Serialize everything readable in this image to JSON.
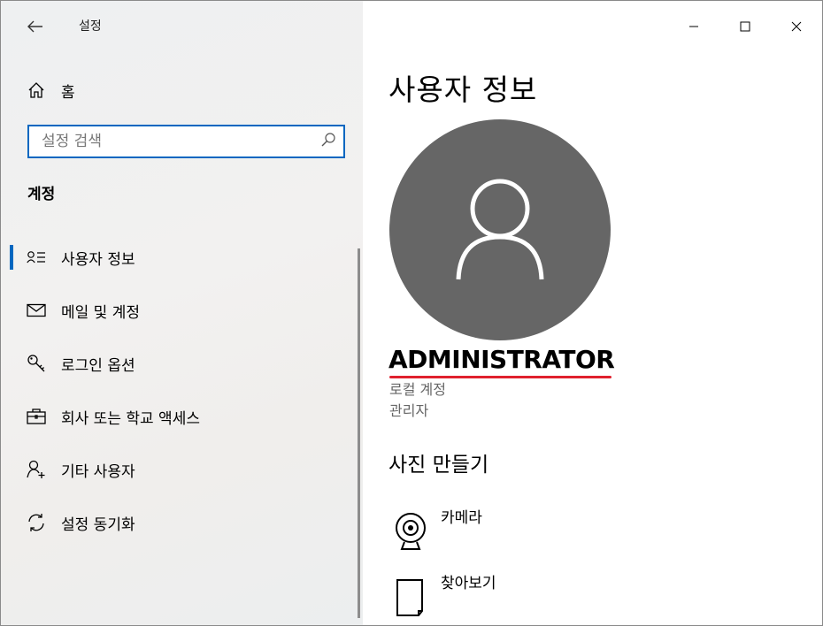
{
  "window": {
    "app_title": "설정",
    "controls": {
      "minimize": "minimize-icon",
      "maximize": "maximize-icon",
      "close": "close-icon"
    }
  },
  "sidebar": {
    "back_icon": "back-arrow-icon",
    "home": {
      "label": "홈",
      "icon": "home-icon"
    },
    "search": {
      "placeholder": "설정 검색",
      "value": "",
      "icon": "search-icon"
    },
    "section_title": "계정",
    "items": [
      {
        "label": "사용자 정보",
        "icon": "user-info-icon",
        "selected": true
      },
      {
        "label": "메일 및 계정",
        "icon": "mail-icon",
        "selected": false
      },
      {
        "label": "로그인 옵션",
        "icon": "key-icon",
        "selected": false
      },
      {
        "label": "회사 또는 학교 액세스",
        "icon": "briefcase-icon",
        "selected": false
      },
      {
        "label": "기타 사용자",
        "icon": "add-user-icon",
        "selected": false
      },
      {
        "label": "설정 동기화",
        "icon": "sync-icon",
        "selected": false
      }
    ]
  },
  "main": {
    "page_title": "사용자 정보",
    "avatar_icon": "user-silhouette-icon",
    "username": "ADMINISTRATOR",
    "account_type": "로컬 계정",
    "account_role": "관리자",
    "create_photo_title": "사진 만들기",
    "photo_options": [
      {
        "label": "카메라",
        "icon": "webcam-icon"
      },
      {
        "label": "찾아보기",
        "icon": "file-browse-icon"
      }
    ]
  },
  "colors": {
    "accent": "#0067c0",
    "avatar_bg": "#666666",
    "annotation_underline": "#e0202e",
    "secondary_text": "#666666"
  }
}
